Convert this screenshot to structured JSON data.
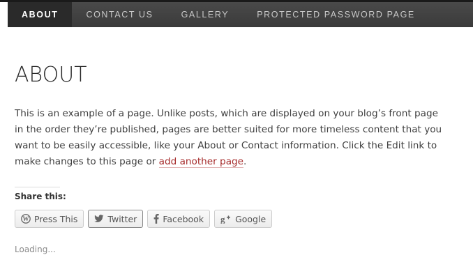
{
  "nav": {
    "items": [
      {
        "label": "ABOUT",
        "active": true
      },
      {
        "label": "CONTACT US",
        "active": false
      },
      {
        "label": "GALLERY",
        "active": false
      },
      {
        "label": "PROTECTED PASSWORD PAGE",
        "active": false
      }
    ]
  },
  "page": {
    "title": "ABOUT",
    "body_before_link": "This is an example of a page. Unlike posts, which are displayed on your blog’s front page in the order they’re published, pages are better suited for more timeless content that you want to be easily accessible, like your About or Contact information. Click the Edit link to make changes to this page or ",
    "link_text": "add another page",
    "body_after_link": "."
  },
  "share": {
    "title": "Share this:",
    "buttons": [
      {
        "label": "Press This",
        "icon": "wordpress-icon"
      },
      {
        "label": "Twitter",
        "icon": "twitter-icon"
      },
      {
        "label": "Facebook",
        "icon": "facebook-icon"
      },
      {
        "label": "Google",
        "icon": "google-plus-icon"
      }
    ]
  },
  "loading_text": "Loading...",
  "colors": {
    "nav_bg": "#404040",
    "nav_active_bg": "#2a2a2a",
    "link": "#a52a2a"
  }
}
